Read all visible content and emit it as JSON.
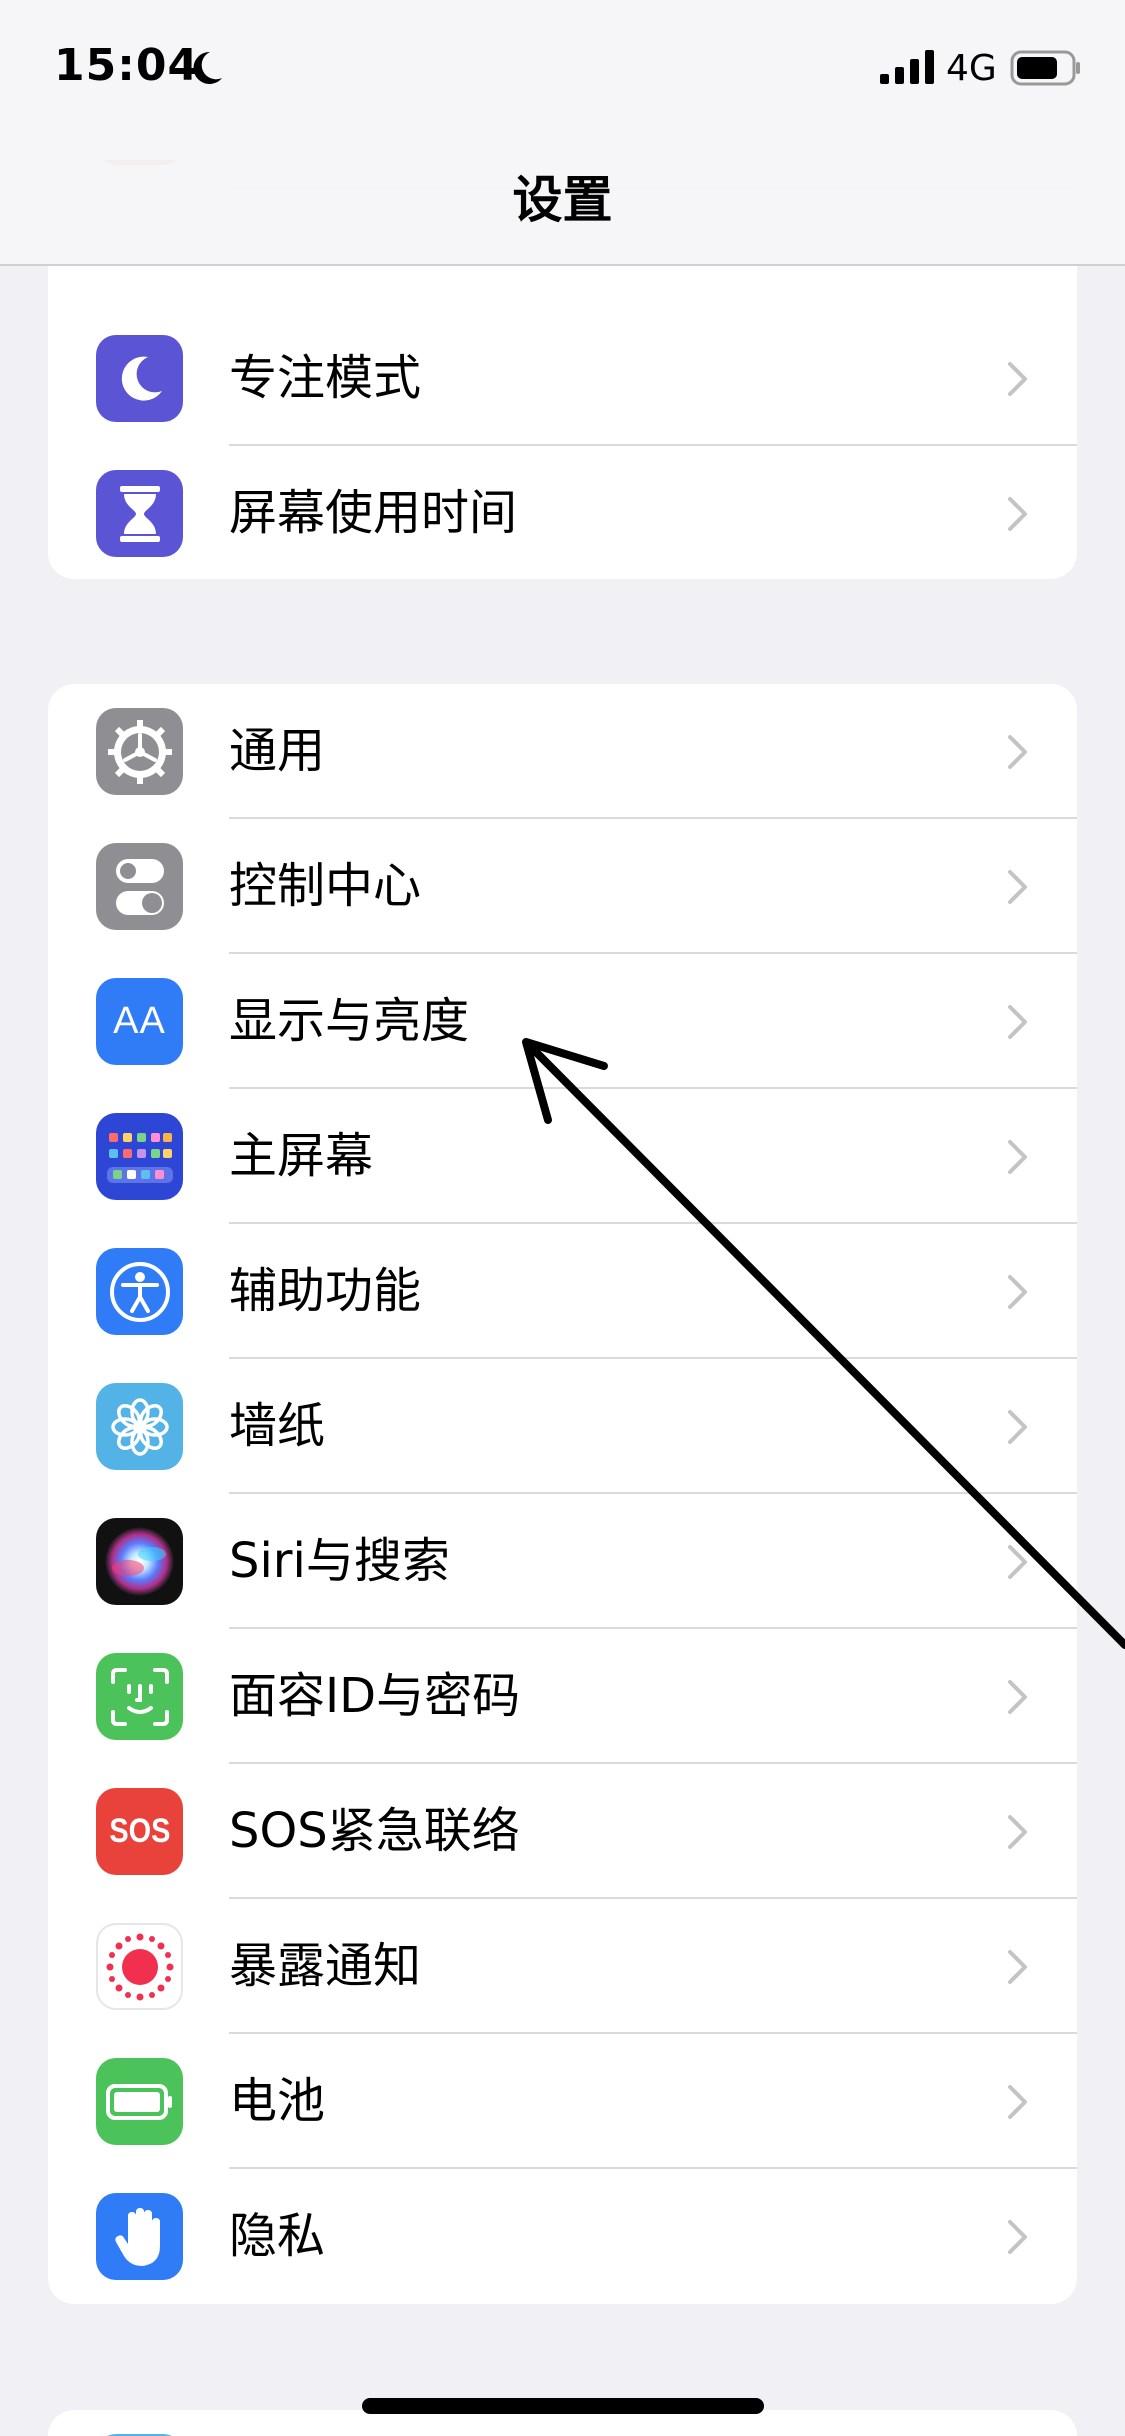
{
  "status_bar": {
    "time": "15:04",
    "network": "4G"
  },
  "nav": {
    "title": "设置"
  },
  "groups": [
    {
      "items": [
        {
          "label": "",
          "icon": "sound-icon",
          "color": "#e8425a"
        },
        {
          "label": "专注模式",
          "icon": "moon-icon",
          "color": "#5b55d6"
        },
        {
          "label": "屏幕使用时间",
          "icon": "hourglass-icon",
          "color": "#5b55d6"
        }
      ]
    },
    {
      "items": [
        {
          "label": "通用",
          "icon": "gear-icon",
          "color": "#8e8e93"
        },
        {
          "label": "控制中心",
          "icon": "toggles-icon",
          "color": "#8e8e93"
        },
        {
          "label": "显示与亮度",
          "icon": "text-size-icon",
          "color": "#2f7cf6"
        },
        {
          "label": "主屏幕",
          "icon": "home-grid-icon",
          "color": "#2d46d6"
        },
        {
          "label": "辅助功能",
          "icon": "accessibility-icon",
          "color": "#2f7cf6"
        },
        {
          "label": "墙纸",
          "icon": "flower-icon",
          "color": "#54b3e6"
        },
        {
          "label": "Siri与搜索",
          "icon": "siri-icon",
          "color": "#222222"
        },
        {
          "label": "面容ID与密码",
          "icon": "face-id-icon",
          "color": "#4cc25a"
        },
        {
          "label": "SOS紧急联络",
          "icon": "sos-icon",
          "color": "#e8423a"
        },
        {
          "label": "暴露通知",
          "icon": "exposure-icon",
          "color": "#ffffff"
        },
        {
          "label": "电池",
          "icon": "battery-icon",
          "color": "#4cc25a"
        },
        {
          "label": "隐私",
          "icon": "hand-icon",
          "color": "#2f7cf6"
        }
      ]
    }
  ],
  "sos_icon_text": "SOS",
  "text_size_icon_text": "AA"
}
